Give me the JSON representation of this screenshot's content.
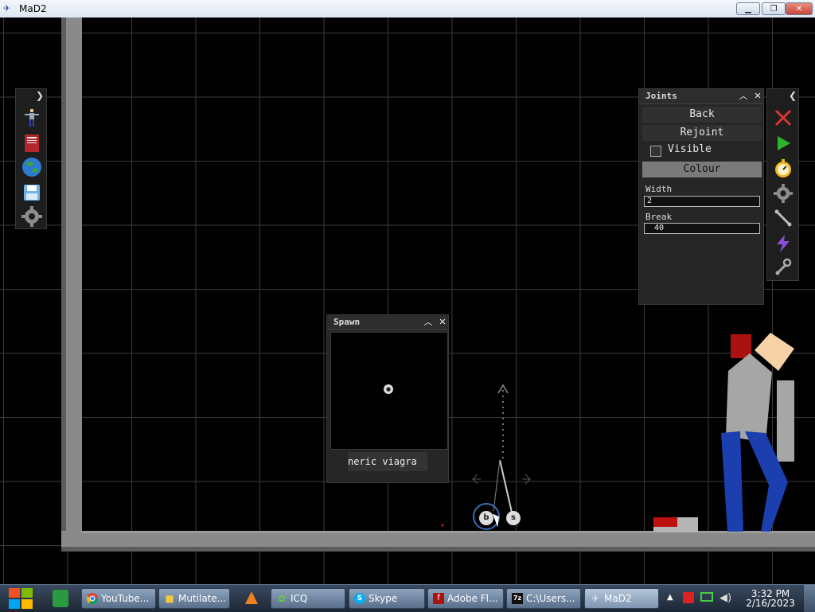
{
  "window": {
    "title": "MaD2",
    "controls": [
      "minimize",
      "restore",
      "close"
    ]
  },
  "left_toolbar": {
    "icons": [
      "ragdoll-icon",
      "book-icon",
      "globe-icon",
      "save-icon",
      "settings-gear-icon"
    ]
  },
  "joints_panel": {
    "title": "Joints",
    "back_label": "Back",
    "rejoint_label": "Rejoint",
    "visible_label": "Visible",
    "visible_checked": false,
    "colour_label": "Colour",
    "width_label": "Width",
    "width_value": "2",
    "break_label": "Break",
    "break_value": "40"
  },
  "right_toolbar": {
    "icons": [
      "delete-x-icon",
      "play-icon",
      "stopwatch-icon",
      "gear-icon",
      "bone-icon",
      "lightning-icon",
      "wrench-icon"
    ]
  },
  "spawn_panel": {
    "title": "Spawn",
    "item_icon": "ball-icon",
    "name_value": "neric viagra"
  },
  "scene": {
    "tool_buttons": [
      "b",
      "s"
    ]
  },
  "taskbar": {
    "tasks": [
      {
        "label": "YouTube...",
        "icon": "chrome-icon"
      },
      {
        "label": "Mutilate...",
        "icon": "folder-icon"
      },
      {
        "label": "ICQ",
        "icon": "icq-icon"
      },
      {
        "label": "Skype",
        "icon": "skype-icon"
      },
      {
        "label": "Adobe Fl...",
        "icon": "flash-icon"
      },
      {
        "label": "C:\\Users...",
        "icon": "7zip-icon"
      },
      {
        "label": "MaD2",
        "icon": "mad2-icon"
      }
    ],
    "clock_time": "3:32 PM",
    "clock_date": "2/16/2023"
  }
}
